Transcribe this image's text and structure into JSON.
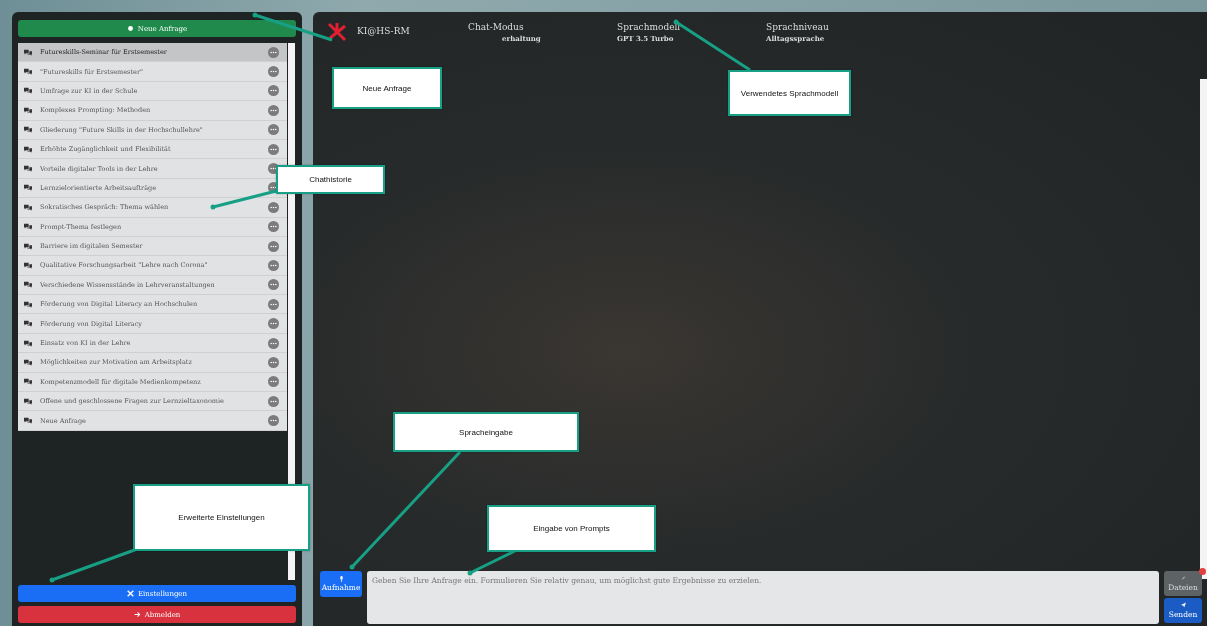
{
  "sidebar": {
    "new_button": "Neue Anfrage",
    "history": [
      {
        "title": "Futureskills-Seminar für Erstsemester",
        "selected": true
      },
      {
        "title": "\"Futureskills für Erstsemester\"",
        "selected": false
      },
      {
        "title": "Umfrage zur KI in der Schule",
        "selected": false
      },
      {
        "title": "Komplexes Prompting: Methoden",
        "selected": false
      },
      {
        "title": "Gliederung \"Future Skills in der Hochschullehre\"",
        "selected": false
      },
      {
        "title": "Erhöhte Zugänglichkeit und Flexibilität",
        "selected": false
      },
      {
        "title": "Vorteile digitaler Tools in der Lehre",
        "selected": false
      },
      {
        "title": "Lernzielorientierte Arbeitsaufträge",
        "selected": false
      },
      {
        "title": "Sokratisches Gespräch: Thema wählen",
        "selected": false
      },
      {
        "title": "Prompt-Thema festlegen",
        "selected": false
      },
      {
        "title": "Barriere im digitalen Semester",
        "selected": false
      },
      {
        "title": "Qualitative Forschungsarbeit \"Lehre nach Corona\"",
        "selected": false
      },
      {
        "title": "Verschiedene Wissensstände in Lehrveranstaltungen",
        "selected": false
      },
      {
        "title": "Förderung von Digital Literacy an Hochschulen",
        "selected": false
      },
      {
        "title": "Förderung von Digital Literacy",
        "selected": false
      },
      {
        "title": "Einsatz von KI in der Lehre",
        "selected": false
      },
      {
        "title": "Möglichkeiten zur Motivation am Arbeitsplatz",
        "selected": false
      },
      {
        "title": "Kompetenzmodell für digitale Medienkompetenz",
        "selected": false
      },
      {
        "title": "Offene und geschlossene Fragen zur Lernzieltaxonomie",
        "selected": false
      },
      {
        "title": "Neue Anfrage",
        "selected": false
      }
    ],
    "settings_button": "Einstellungen",
    "logout_button": "Abmelden"
  },
  "header": {
    "brand": "KI@HS-RM",
    "fields": [
      {
        "label": "Chat-Modus",
        "value": "erhaltung"
      },
      {
        "label": "Sprachmodell",
        "value": "GPT 3.5 Turbo"
      },
      {
        "label": "Sprachniveau",
        "value": "Alltagssprache"
      }
    ]
  },
  "input": {
    "record_button": "Aufnahme",
    "placeholder": "Geben Sie Ihre Anfrage ein. Formulieren Sie relativ genau, um möglichst gute Ergebnisse zu erzielen.",
    "files_button": "Dateien",
    "send_button": "Senden"
  },
  "annotations": [
    {
      "label": "Neue Anfrage"
    },
    {
      "label": "Verwendetes Sprachmodell"
    },
    {
      "label": "Chathistorie"
    },
    {
      "label": "Spracheingabe"
    },
    {
      "label": "Eingabe von Prompts"
    },
    {
      "label": "Erweiterte Einstellungen"
    }
  ]
}
